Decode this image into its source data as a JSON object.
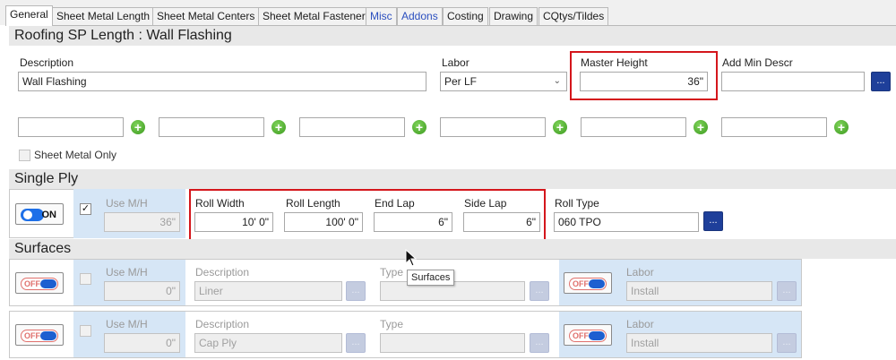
{
  "tabs": [
    {
      "label": "General",
      "active": true
    },
    {
      "label": "Sheet Metal Length"
    },
    {
      "label": "Sheet Metal Centers"
    },
    {
      "label": "Sheet Metal Fastener"
    },
    {
      "label": "Misc",
      "blue": true
    },
    {
      "label": "Addons",
      "blue": true
    },
    {
      "label": "Costing"
    },
    {
      "label": "Drawing"
    },
    {
      "label": "CQtys/Tildes"
    }
  ],
  "header": {
    "title": "Roofing SP Length : Wall Flashing"
  },
  "general": {
    "description_label": "Description",
    "description_value": "Wall Flashing",
    "labor_label": "Labor",
    "labor_value": "Per LF",
    "master_height_label": "Master Height",
    "master_height_value": "36\"",
    "add_min_descr_label": "Add Min Descr",
    "add_min_descr_value": "",
    "dots_label": "...",
    "sheet_metal_only_label": "Sheet Metal Only"
  },
  "single_ply": {
    "section_title": "Single Ply",
    "toggle_state": "ON",
    "use_mh_label": "Use M/H",
    "use_mh_checked": true,
    "use_mh_value": "36\"",
    "roll_width_label": "Roll Width",
    "roll_width_value": "10' 0\"",
    "roll_length_label": "Roll Length",
    "roll_length_value": "100' 0\"",
    "end_lap_label": "End Lap",
    "end_lap_value": "6\"",
    "side_lap_label": "Side Lap",
    "side_lap_value": "6\"",
    "roll_type_label": "Roll Type",
    "roll_type_value": "060 TPO"
  },
  "surfaces": {
    "section_title": "Surfaces",
    "tooltip": "Surfaces",
    "rows": [
      {
        "toggle_state": "OFF",
        "use_mh_label": "Use M/H",
        "use_mh_value": "0\"",
        "description_label": "Description",
        "description_value": "Liner",
        "type_label": "Type",
        "type_value": "",
        "labor_toggle_state": "OFF",
        "labor_label": "Labor",
        "labor_value": "Install"
      },
      {
        "toggle_state": "OFF",
        "use_mh_label": "Use M/H",
        "use_mh_value": "0\"",
        "description_label": "Description",
        "description_value": "Cap Ply",
        "type_label": "Type",
        "type_value": "",
        "labor_toggle_state": "OFF",
        "labor_label": "Labor",
        "labor_value": "Install"
      }
    ]
  },
  "colors": {
    "highlight_red": "#d4161c",
    "button_blue": "#1e3f9a",
    "toggle_blue": "#1d6fe8",
    "plus_green": "#3c9a1f"
  }
}
